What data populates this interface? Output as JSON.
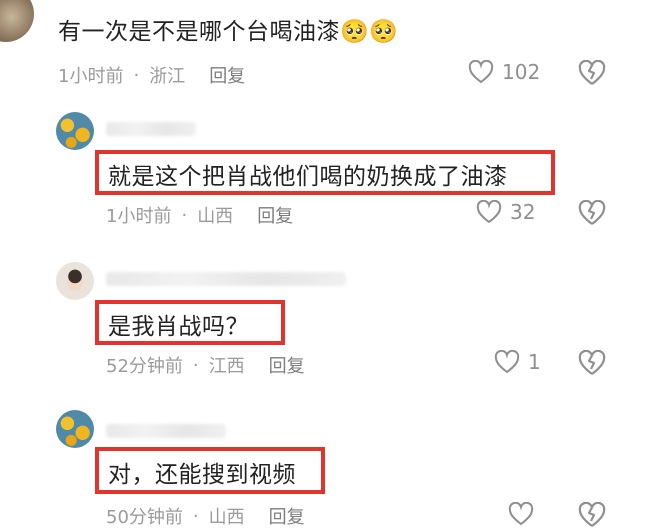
{
  "comments": [
    {
      "text": "有一次是不是哪个台喝油漆",
      "emoji": "🥺🥺",
      "time": "1小时前",
      "location": "浙江",
      "reply_label": "回复",
      "likes": "102"
    },
    {
      "text": "就是这个把肖战他们喝的奶换成了油漆",
      "time": "1小时前",
      "location": "山西",
      "reply_label": "回复",
      "likes": "32"
    },
    {
      "text": "是我肖战吗？",
      "time": "52分钟前",
      "location": "江西",
      "reply_label": "回复",
      "likes": "1"
    },
    {
      "text": "对，还能搜到视频",
      "time": "50分钟前",
      "location": "山西",
      "reply_label": "回复",
      "likes": ""
    }
  ],
  "separator": "·",
  "colors": {
    "highlight": "#e2332c",
    "meta": "#9b9b9b"
  },
  "icons": [
    "heart-outline-icon",
    "broken-heart-icon",
    "avatar-sunflower",
    "avatar-person"
  ]
}
